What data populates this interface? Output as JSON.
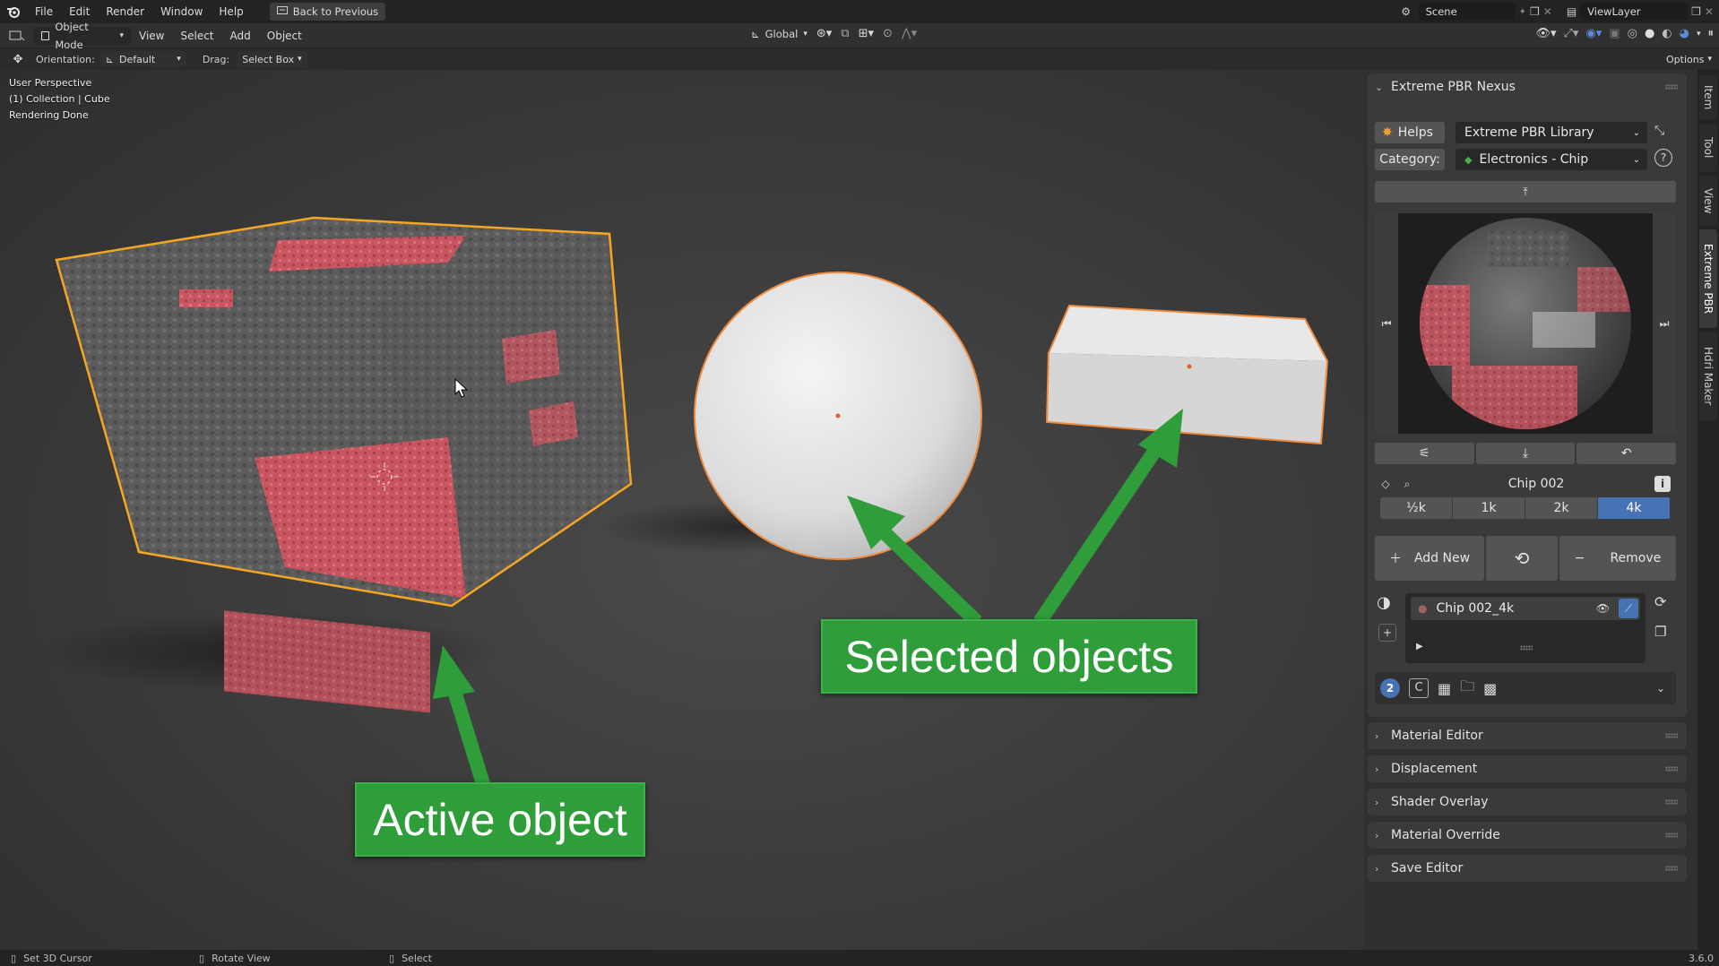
{
  "menubar": {
    "items": [
      "File",
      "Edit",
      "Render",
      "Window",
      "Help"
    ],
    "back_button": "Back to Previous",
    "scene": "Scene",
    "view_layer": "ViewLayer"
  },
  "header": {
    "mode": "Object Mode",
    "menus": [
      "View",
      "Select",
      "Add",
      "Object"
    ],
    "transform_orientation": "Global"
  },
  "tool_settings": {
    "orientation_label": "Orientation:",
    "orientation_value": "Default",
    "drag_label": "Drag:",
    "drag_value": "Select Box",
    "options": "Options"
  },
  "viewport": {
    "info": [
      "User Perspective",
      "(1) Collection | Cube",
      "Rendering Done"
    ]
  },
  "callouts": {
    "selected": "Selected objects",
    "active": "Active object"
  },
  "colors": {
    "selection_outline": "#f08a3c",
    "active_outline": "#f5a623",
    "callout_green": "#2e9d3a",
    "accent_blue": "#4772b3"
  },
  "panel": {
    "title": "Extreme PBR Nexus",
    "helps": "Helps",
    "library": "Extreme PBR Library",
    "category_label": "Category:",
    "category": "Electronics - Chip",
    "material_name": "Chip 002",
    "resolutions": [
      "½k",
      "1k",
      "2k",
      "4k"
    ],
    "active_resolution": "4k",
    "add_new": "Add New",
    "remove": "Remove",
    "slot_name": "Chip 002_4k",
    "badge_number": "2",
    "badge_letter": "C"
  },
  "collapsed_panels": [
    "Material Editor",
    "Displacement",
    "Shader Overlay",
    "Material Override",
    "Save Editor"
  ],
  "sidebar_tabs": [
    "Item",
    "Tool",
    "View",
    "Extreme PBR",
    "Hdri Maker"
  ],
  "statusbar": {
    "left": "Set 3D Cursor",
    "middle": "Rotate View",
    "right": "Select",
    "version": "3.6.0"
  }
}
